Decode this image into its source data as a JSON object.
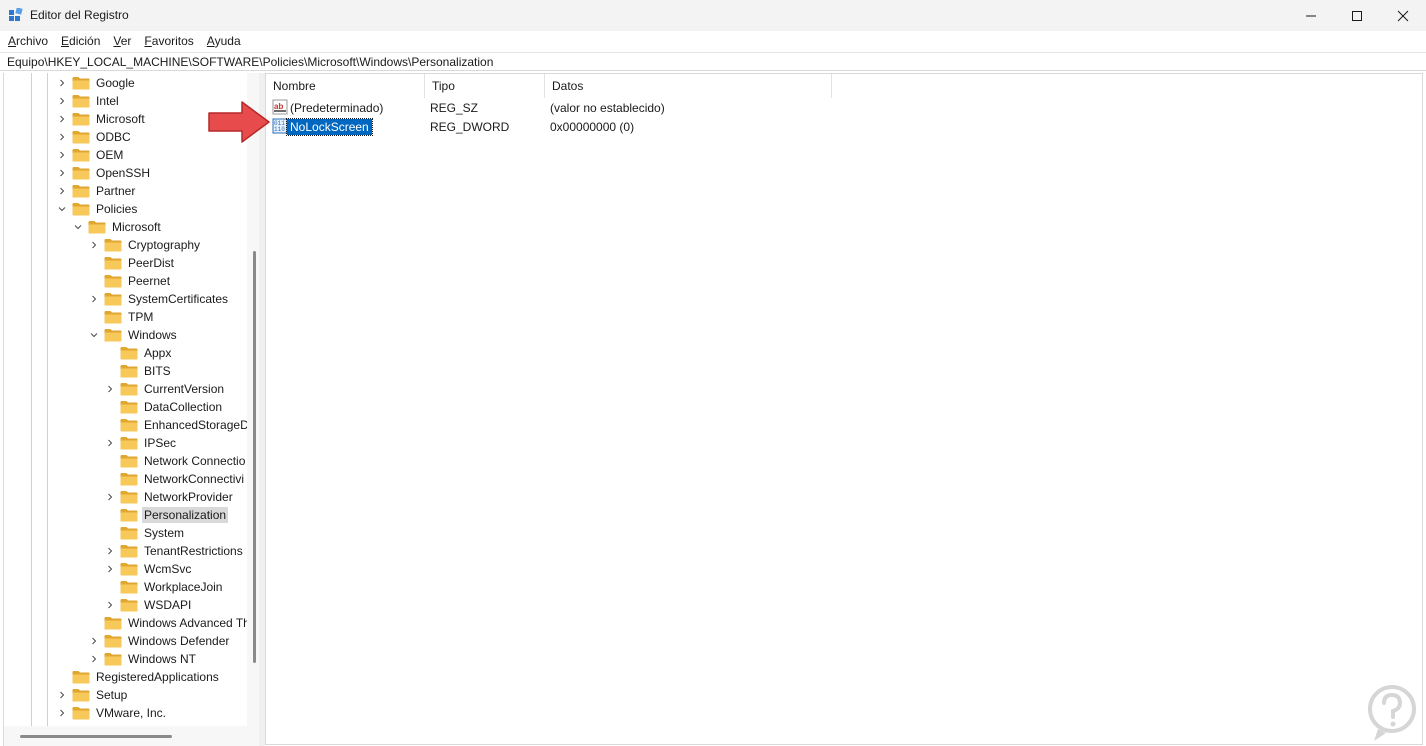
{
  "window": {
    "title": "Editor del Registro",
    "minimize_glyph": "minimize-icon",
    "maximize_glyph": "maximize-icon",
    "close_glyph": "close-icon"
  },
  "menu": [
    {
      "accel": "A",
      "rest": "rchivo"
    },
    {
      "accel": "E",
      "rest": "dición"
    },
    {
      "accel": "V",
      "rest": "er"
    },
    {
      "accel": "F",
      "rest": "avoritos"
    },
    {
      "accel": "A",
      "rest": "yuda"
    }
  ],
  "address": "Equipo\\HKEY_LOCAL_MACHINE\\SOFTWARE\\Policies\\Microsoft\\Windows\\Personalization",
  "tree": [
    {
      "label": "Google",
      "depth": 0,
      "state": "collapsed"
    },
    {
      "label": "Intel",
      "depth": 0,
      "state": "collapsed"
    },
    {
      "label": "Microsoft",
      "depth": 0,
      "state": "collapsed"
    },
    {
      "label": "ODBC",
      "depth": 0,
      "state": "collapsed"
    },
    {
      "label": "OEM",
      "depth": 0,
      "state": "collapsed"
    },
    {
      "label": "OpenSSH",
      "depth": 0,
      "state": "collapsed"
    },
    {
      "label": "Partner",
      "depth": 0,
      "state": "collapsed"
    },
    {
      "label": "Policies",
      "depth": 0,
      "state": "expanded"
    },
    {
      "label": "Microsoft",
      "depth": 1,
      "state": "expanded"
    },
    {
      "label": "Cryptography",
      "depth": 2,
      "state": "collapsed"
    },
    {
      "label": "PeerDist",
      "depth": 2,
      "state": "leaf"
    },
    {
      "label": "Peernet",
      "depth": 2,
      "state": "leaf"
    },
    {
      "label": "SystemCertificates",
      "depth": 2,
      "state": "collapsed"
    },
    {
      "label": "TPM",
      "depth": 2,
      "state": "leaf"
    },
    {
      "label": "Windows",
      "depth": 2,
      "state": "expanded"
    },
    {
      "label": "Appx",
      "depth": 3,
      "state": "leaf"
    },
    {
      "label": "BITS",
      "depth": 3,
      "state": "leaf"
    },
    {
      "label": "CurrentVersion",
      "depth": 3,
      "state": "collapsed"
    },
    {
      "label": "DataCollection",
      "depth": 3,
      "state": "leaf"
    },
    {
      "label": "EnhancedStorageDe",
      "depth": 3,
      "state": "leaf"
    },
    {
      "label": "IPSec",
      "depth": 3,
      "state": "collapsed"
    },
    {
      "label": "Network Connectio",
      "depth": 3,
      "state": "leaf"
    },
    {
      "label": "NetworkConnectivi",
      "depth": 3,
      "state": "leaf"
    },
    {
      "label": "NetworkProvider",
      "depth": 3,
      "state": "collapsed"
    },
    {
      "label": "Personalization",
      "depth": 3,
      "state": "leaf",
      "selected": true
    },
    {
      "label": "System",
      "depth": 3,
      "state": "leaf"
    },
    {
      "label": "TenantRestrictions",
      "depth": 3,
      "state": "collapsed"
    },
    {
      "label": "WcmSvc",
      "depth": 3,
      "state": "collapsed"
    },
    {
      "label": "WorkplaceJoin",
      "depth": 3,
      "state": "leaf"
    },
    {
      "label": "WSDAPI",
      "depth": 3,
      "state": "collapsed"
    },
    {
      "label": "Windows Advanced Th",
      "depth": 2,
      "state": "leaf"
    },
    {
      "label": "Windows Defender",
      "depth": 2,
      "state": "collapsed"
    },
    {
      "label": "Windows NT",
      "depth": 2,
      "state": "collapsed"
    },
    {
      "label": "RegisteredApplications",
      "depth": 0,
      "state": "leaf"
    },
    {
      "label": "Setup",
      "depth": 0,
      "state": "collapsed"
    },
    {
      "label": "VMware, Inc.",
      "depth": 0,
      "state": "collapsed"
    }
  ],
  "list": {
    "columns": [
      "Nombre",
      "Tipo",
      "Datos"
    ],
    "rows": [
      {
        "name": "(Predeterminado)",
        "type": "REG_SZ",
        "data": "(valor no establecido)",
        "icon": "string-value-icon",
        "highlight": false
      },
      {
        "name": "NoLockScreen",
        "type": "REG_DWORD",
        "data": "0x00000000 (0)",
        "icon": "dword-value-icon",
        "highlight": true
      }
    ]
  },
  "colors": {
    "selection": "#0067c0",
    "folder": "#f6c95a",
    "arrow": "#e84b4b"
  }
}
